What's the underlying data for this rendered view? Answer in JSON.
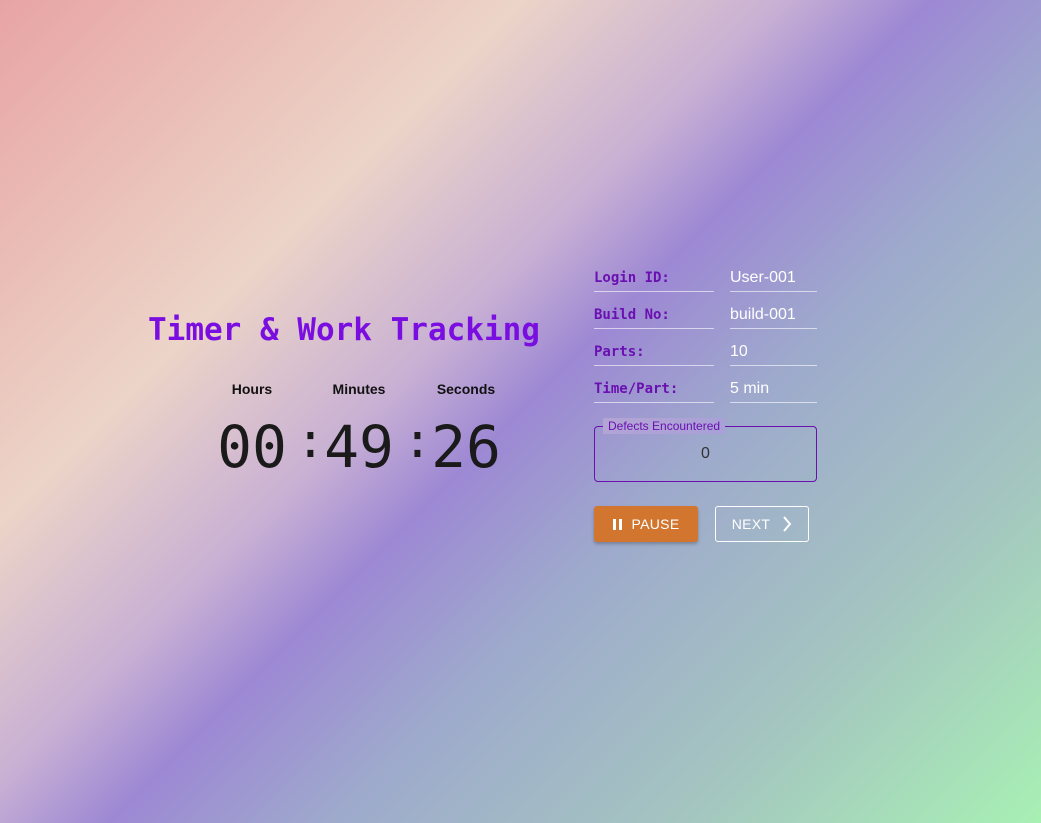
{
  "title": "Timer & Work Tracking",
  "timer": {
    "labels": {
      "hours": "Hours",
      "minutes": "Minutes",
      "seconds": "Seconds"
    },
    "hours": "00",
    "minutes": "49",
    "seconds": "26",
    "separator": ":"
  },
  "info": {
    "login_id": {
      "label": "Login ID:",
      "value": "User-001"
    },
    "build_no": {
      "label": "Build No:",
      "value": "build-001"
    },
    "parts": {
      "label": "Parts:",
      "value": "10"
    },
    "time_per_part": {
      "label": "Time/Part:",
      "value": "5 min"
    }
  },
  "defects": {
    "label": "Defects Encountered",
    "value": "0"
  },
  "buttons": {
    "pause": {
      "label": "PAUSE",
      "icon": "pause-icon"
    },
    "next": {
      "label": "NEXT",
      "icon": "chevron-right-icon"
    }
  },
  "colors": {
    "title": "#7a0ee0",
    "label": "#6a10b0",
    "pause_button": "#d2762f"
  }
}
